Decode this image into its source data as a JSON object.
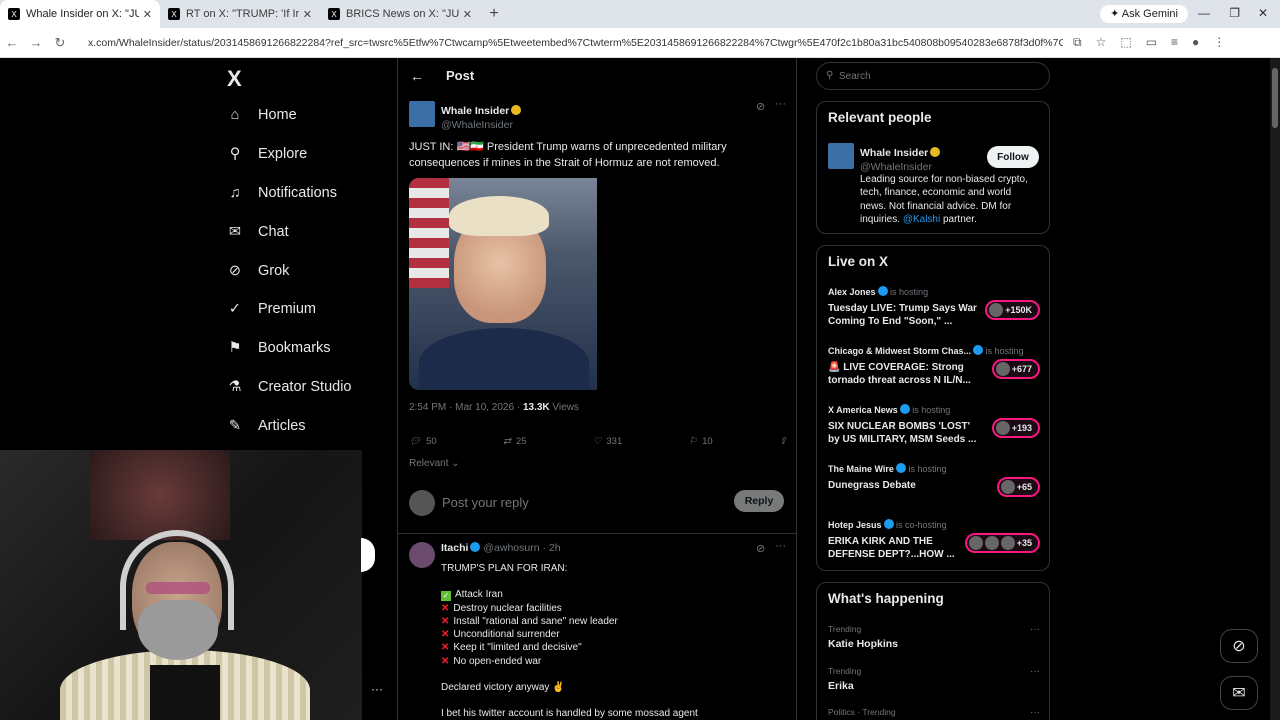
{
  "browser": {
    "tabs": [
      {
        "title": "Whale Insider on X: \"JUST IN: u",
        "active": true
      },
      {
        "title": "RT on X: \"TRUMP: 'If Iran has pu",
        "active": false
      },
      {
        "title": "BRICS News on X: \"JUST IN: usr",
        "active": false
      }
    ],
    "gemini": "Ask Gemini",
    "url": "x.com/WhaleInsider/status/2031458691266822284?ref_src=twsrc%5Etfw%7Ctwcamp%5Etweetembed%7Ctwterm%5E2031458691266822284%7Ctwgr%5E470f2c1b80a31bc540808b09540283e6878f3d0f%7Ctwcon%5Es1_&ref_url=https%..."
  },
  "nav": {
    "logo": "X",
    "items": [
      "Home",
      "Explore",
      "Notifications",
      "Chat",
      "Grok",
      "Premium",
      "Bookmarks",
      "Creator Studio",
      "Articles"
    ]
  },
  "post": {
    "header": "Post",
    "author_name": "Whale Insider",
    "author_handle": "@WhaleInsider",
    "text": "JUST IN: 🇺🇸🇮🇷 President Trump warns of unprecedented military consequences if mines in the Strait of Hormuz are not removed.",
    "time": "2:54 PM · Mar 10, 2026 · ",
    "views_count": "13.3K",
    "views_label": " Views",
    "replies": "50",
    "reposts": "25",
    "likes": "331",
    "bookmarks": "10",
    "sort": "Relevant"
  },
  "reply_box": {
    "placeholder": "Post your reply",
    "button": "Reply"
  },
  "reply": {
    "name": "Itachi",
    "handle": "@awhosurn",
    "time": "· 2h",
    "heading": "TRUMP'S PLAN FOR IRAN:",
    "check_item": "Attack Iran",
    "cross_items": [
      "Destroy nuclear facilities",
      "Install \"rational and sane\" new leader",
      "Unconditional surrender",
      "Keep it \"limited and decisive\"",
      "No open-ended war"
    ],
    "declared": "Declared victory anyway ✌",
    "last": "I bet his twitter account is handled by some mossad agent"
  },
  "sidebar": {
    "search_placeholder": "Search",
    "relevant_title": "Relevant people",
    "person_name": "Whale Insider",
    "person_handle": "@WhaleInsider",
    "follow": "Follow",
    "bio_prefix": "Leading source for non-biased crypto, tech, finance, economic and world news. Not financial advice. DM for inquiries. ",
    "bio_link": "@Kalshi",
    "bio_suffix": " partner.",
    "live_title": "Live on X",
    "live": [
      {
        "who": "Alex Jones",
        "status": "is hosting",
        "title": "Tuesday LIVE: Trump Says War Coming To End \"Soon,\" ...",
        "count": "+150K"
      },
      {
        "who": "Chicago & Midwest Storm Chas...",
        "status": "is hosting",
        "title": "🚨 LIVE COVERAGE: Strong tornado threat across N IL/N...",
        "count": "+677"
      },
      {
        "who": "X America News",
        "status": "is hosting",
        "title": "SIX NUCLEAR BOMBS 'LOST' by US MILITARY, MSM Seeds ...",
        "count": "+193"
      },
      {
        "who": "The Maine Wire",
        "status": "is hosting",
        "title": "Dunegrass Debate",
        "count": "+65"
      },
      {
        "who": "Hotep Jesus",
        "status": "is co-hosting",
        "title": "ERIKA KIRK AND THE DEFENSE DEPT?...HOW ...",
        "count": "+35"
      }
    ],
    "happening_title": "What's happening",
    "trends": [
      {
        "cat": "Trending",
        "title": "Katie Hopkins"
      },
      {
        "cat": "Trending",
        "title": "Erika"
      },
      {
        "cat": "Politics · Trending",
        "title": ""
      }
    ]
  },
  "colors": {
    "background": "#000000",
    "accent": "#1d9bf0",
    "live": "#f91880"
  }
}
